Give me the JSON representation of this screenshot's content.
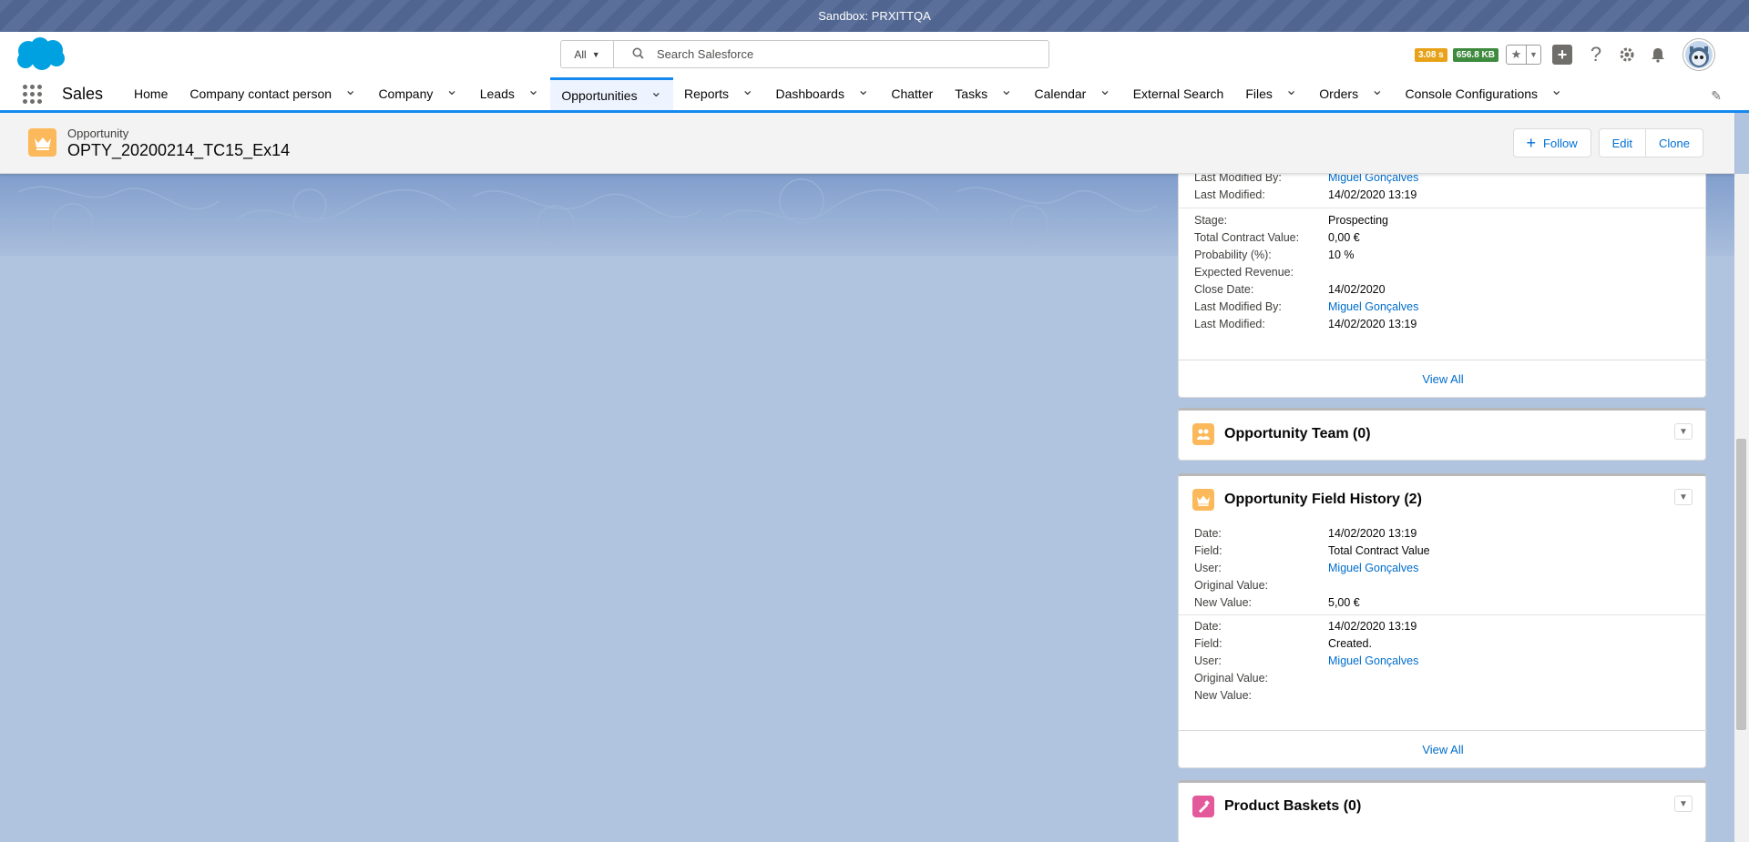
{
  "sandbox": {
    "label": "Sandbox: PRXITTQA"
  },
  "header": {
    "search_scope": "All",
    "search_placeholder": "Search Salesforce",
    "perf_time": "3.08 s",
    "perf_memory": "656.8 KB"
  },
  "nav": {
    "app_name": "Sales",
    "items": [
      {
        "label": "Home",
        "has_menu": false
      },
      {
        "label": "Company contact person",
        "has_menu": true
      },
      {
        "label": "Company",
        "has_menu": true
      },
      {
        "label": "Leads",
        "has_menu": true
      },
      {
        "label": "Opportunities",
        "has_menu": true,
        "active": true
      },
      {
        "label": "Reports",
        "has_menu": true
      },
      {
        "label": "Dashboards",
        "has_menu": true
      },
      {
        "label": "Chatter",
        "has_menu": false
      },
      {
        "label": "Tasks",
        "has_menu": true
      },
      {
        "label": "Calendar",
        "has_menu": true
      },
      {
        "label": "External Search",
        "has_menu": false
      },
      {
        "label": "Files",
        "has_menu": true
      },
      {
        "label": "Orders",
        "has_menu": true
      },
      {
        "label": "Console Configurations",
        "has_menu": true
      }
    ]
  },
  "record": {
    "type": "Opportunity",
    "title": "OPTY_20200214_TC15_Ex14",
    "follow_label": "Follow",
    "edit_label": "Edit",
    "clone_label": "Clone"
  },
  "history_card": {
    "top_rows": [
      {
        "k": "Last Modified By:",
        "v": "Miguel Gonçalves",
        "link": true
      },
      {
        "k": "Last Modified:",
        "v": "14/02/2020 13:19",
        "link": false
      }
    ],
    "rows": [
      {
        "k": "Stage:",
        "v": "Prospecting",
        "link": false
      },
      {
        "k": "Total Contract Value:",
        "v": "0,00 €",
        "link": false
      },
      {
        "k": "Probability (%):",
        "v": "10 %",
        "link": false
      },
      {
        "k": "Expected Revenue:",
        "v": "",
        "link": false
      },
      {
        "k": "Close Date:",
        "v": "14/02/2020",
        "link": false
      },
      {
        "k": "Last Modified By:",
        "v": "Miguel Gonçalves",
        "link": true
      },
      {
        "k": "Last Modified:",
        "v": "14/02/2020 13:19",
        "link": false
      }
    ],
    "view_all": "View All"
  },
  "team_card": {
    "title": "Opportunity Team (0)"
  },
  "field_history_card": {
    "title": "Opportunity Field History (2)",
    "entries": [
      [
        {
          "k": "Date:",
          "v": "14/02/2020 13:19",
          "link": false
        },
        {
          "k": "Field:",
          "v": "Total Contract Value",
          "link": false
        },
        {
          "k": "User:",
          "v": "Miguel Gonçalves",
          "link": true
        },
        {
          "k": "Original Value:",
          "v": "",
          "link": false
        },
        {
          "k": "New Value:",
          "v": "5,00 €",
          "link": false
        }
      ],
      [
        {
          "k": "Date:",
          "v": "14/02/2020 13:19",
          "link": false
        },
        {
          "k": "Field:",
          "v": "Created.",
          "link": false
        },
        {
          "k": "User:",
          "v": "Miguel Gonçalves",
          "link": true
        },
        {
          "k": "Original Value:",
          "v": "",
          "link": false
        },
        {
          "k": "New Value:",
          "v": "",
          "link": false
        }
      ]
    ],
    "view_all": "View All"
  },
  "baskets_card": {
    "title": "Product Baskets (0)"
  },
  "colors": {
    "brand": "#1589ee",
    "opportunity_icon": "#fcb95b",
    "basket_icon": "#e3599b"
  }
}
